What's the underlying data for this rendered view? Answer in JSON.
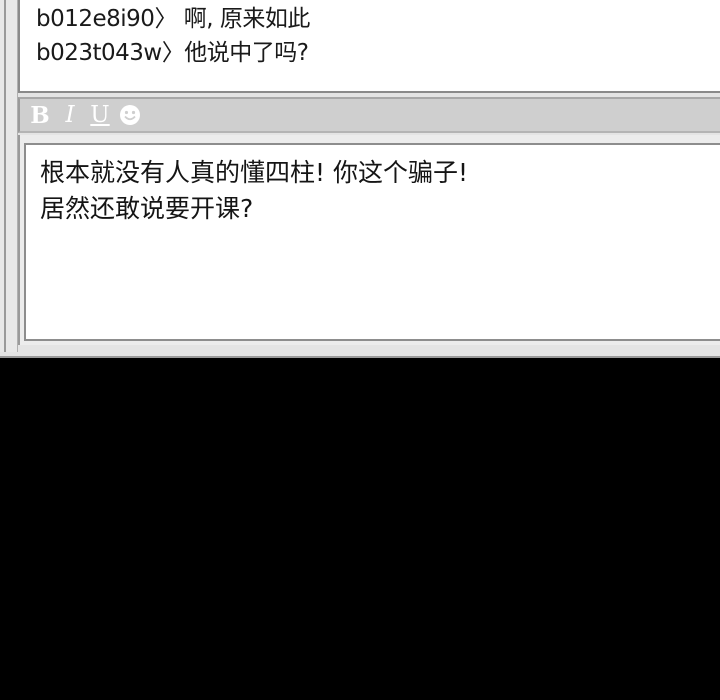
{
  "chat_log": {
    "lines": [
      "b012e8i90〉 啊, 原来如此",
      "b023t043w〉他说中了吗?"
    ]
  },
  "toolbar": {
    "bold_label": "B",
    "italic_label": "I",
    "underline_label": "U",
    "emoji_icon": "smiley-icon"
  },
  "compose": {
    "text": "根本就没有人真的懂四柱! 你这个骗子!\n居然还敢说要开课?"
  }
}
